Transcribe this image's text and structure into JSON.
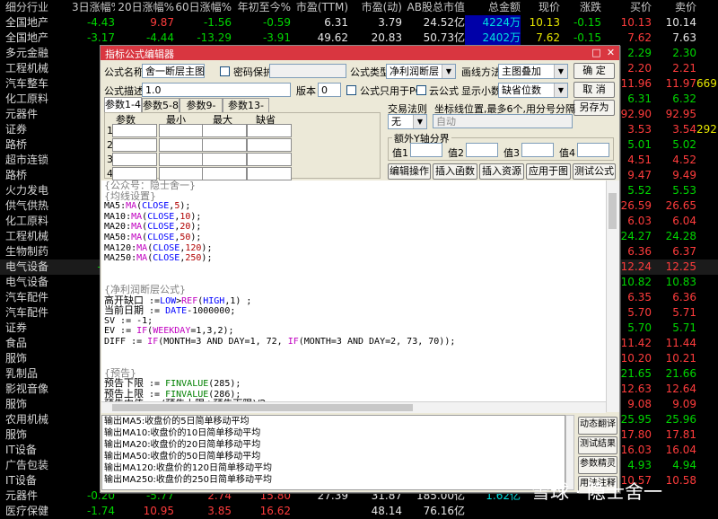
{
  "table": {
    "columns": [
      "细分行业",
      "3日涨幅%",
      "20日涨幅%",
      "60日涨幅%",
      "年初至今%",
      "市盈(TTM)",
      "市盈(动)",
      "AB股总市值",
      "总金额",
      "现价",
      "涨跌",
      "买价",
      "卖价"
    ],
    "rows": [
      [
        "全国地产",
        "-4.43",
        "9.87",
        "-1.56",
        "-0.59",
        "6.31",
        "3.79",
        "24.52亿",
        "4224万",
        "10.13",
        "-0.15",
        "10.13",
        "10.14"
      ],
      [
        "全国地产",
        "-3.17",
        "-4.44",
        "-13.29",
        "-3.91",
        "49.62",
        "20.83",
        "50.73亿",
        "2402万",
        "7.62",
        "-0.15",
        "7.62",
        "7.63"
      ],
      [
        "多元金融",
        "",
        "",
        "",
        "",
        "",
        "",
        "",
        "",
        "",
        "",
        "2.29",
        "2.30"
      ],
      [
        "工程机械",
        "",
        "",
        "",
        "",
        "",
        "",
        "",
        "",
        "",
        "",
        "2.20",
        "2.21"
      ],
      [
        "汽车整车",
        "",
        "",
        "",
        "",
        "",
        "",
        "",
        "",
        "",
        "",
        "11.96",
        "11.97"
      ],
      [
        "化工原料",
        "",
        "",
        "",
        "",
        "",
        "",
        "",
        "",
        "",
        "",
        "6.31",
        "6.32"
      ],
      [
        "元器件",
        "",
        "",
        "",
        "",
        "",
        "",
        "",
        "",
        "",
        "",
        "92.90",
        "92.95"
      ],
      [
        "证券",
        "",
        "",
        "",
        "",
        "",
        "",
        "",
        "",
        "",
        "",
        "3.53",
        "3.54"
      ],
      [
        "路桥",
        "",
        "",
        "",
        "",
        "",
        "",
        "",
        "",
        "",
        "",
        "5.01",
        "5.02"
      ],
      [
        "超市连锁",
        "",
        "",
        "",
        "",
        "",
        "",
        "",
        "",
        "",
        "",
        "4.51",
        "4.52"
      ],
      [
        "路桥",
        "",
        "",
        "",
        "",
        "",
        "",
        "",
        "",
        "",
        "",
        "9.47",
        "9.49"
      ],
      [
        "火力发电",
        "",
        "",
        "",
        "",
        "",
        "",
        "",
        "",
        "",
        "",
        "5.52",
        "5.53"
      ],
      [
        "供气供热",
        "",
        "",
        "",
        "",
        "",
        "",
        "",
        "",
        "",
        "",
        "26.59",
        "26.65"
      ],
      [
        "化工原料",
        "",
        "",
        "",
        "",
        "",
        "",
        "",
        "",
        "",
        "",
        "6.03",
        "6.04"
      ],
      [
        "工程机械",
        "",
        "",
        "",
        "",
        "",
        "",
        "",
        "",
        "",
        "",
        "24.27",
        "24.28"
      ],
      [
        "生物制药",
        "",
        "",
        "",
        "",
        "",
        "",
        "",
        "",
        "",
        "",
        "6.36",
        "6.37"
      ],
      [
        "电气设备",
        "-11",
        "",
        "",
        "",
        "",
        "",
        "",
        "",
        "",
        "",
        "12.24",
        "12.25"
      ],
      [
        "电气设备",
        "",
        "",
        "",
        "",
        "",
        "",
        "",
        "",
        "",
        "",
        "10.82",
        "10.83"
      ],
      [
        "汽车配件",
        "",
        "",
        "",
        "",
        "",
        "",
        "",
        "",
        "",
        "",
        "6.35",
        "6.36"
      ],
      [
        "汽车配件",
        "",
        "",
        "",
        "",
        "",
        "",
        "",
        "",
        "",
        "",
        "5.70",
        "5.71"
      ],
      [
        "证券",
        "",
        "",
        "",
        "",
        "",
        "",
        "",
        "",
        "",
        "",
        "5.70",
        "5.71"
      ],
      [
        "食品",
        "",
        "",
        "",
        "",
        "",
        "",
        "",
        "",
        "",
        "",
        "11.42",
        "11.44"
      ],
      [
        "服饰",
        "",
        "",
        "",
        "",
        "",
        "",
        "",
        "",
        "",
        "",
        "10.20",
        "10.21"
      ],
      [
        "乳制品",
        "",
        "",
        "",
        "",
        "",
        "",
        "",
        "",
        "",
        "",
        "21.65",
        "21.66"
      ],
      [
        "影视音像",
        "",
        "",
        "",
        "",
        "",
        "",
        "",
        "",
        "",
        "",
        "12.63",
        "12.64"
      ],
      [
        "服饰",
        "",
        "",
        "",
        "",
        "",
        "",
        "",
        "",
        "",
        "",
        "9.08",
        "9.09"
      ],
      [
        "农用机械",
        "",
        "",
        "",
        "",
        "",
        "",
        "",
        "",
        "",
        "",
        "25.95",
        "25.96"
      ],
      [
        "服饰",
        "",
        "",
        "",
        "",
        "",
        "",
        "",
        "",
        "",
        "",
        "17.80",
        "17.81"
      ],
      [
        "IT设备",
        "",
        "",
        "",
        "",
        "",
        "",
        "",
        "",
        "",
        "",
        "16.03",
        "16.04"
      ],
      [
        "广告包装",
        "",
        "",
        "",
        "",
        "",
        "",
        "",
        "",
        "",
        "",
        "4.93",
        "4.94"
      ],
      [
        "IT设备",
        "",
        "",
        "",
        "",
        "",
        "",
        "",
        "",
        "",
        "",
        "10.57",
        "10.58"
      ],
      [
        "元器件",
        "-0.20",
        "-5.77",
        "2.74",
        "15.80",
        "27.39",
        "31.87",
        "185.00亿",
        "1.62亿",
        "",
        "",
        "",
        ""
      ],
      [
        "医疗保健",
        "-1.74",
        "10.95",
        "3.85",
        "16.62",
        "",
        "48.14",
        "76.16亿",
        "",
        "",
        "",
        "",
        ""
      ]
    ],
    "right_partial": [
      "",
      "",
      "",
      "",
      "669",
      "",
      "",
      "292",
      "",
      "",
      "",
      "",
      "",
      "",
      "",
      "",
      "",
      "",
      "",
      "",
      "",
      "",
      "",
      "",
      "",
      "",
      "",
      "",
      "",
      "",
      "",
      "",
      ""
    ]
  },
  "dialog": {
    "title": "指标公式编辑器",
    "formula_name_label": "公式名称",
    "formula_name_value": "舍一断层主图",
    "password_label": "密码保护",
    "formula_type_label": "公式类型",
    "formula_type_value": "净利润断层",
    "draw_method_label": "画线方法",
    "draw_method_value": "主图叠加",
    "confirm_label": "确 定",
    "description_label": "公式描述",
    "description_value": "1.0",
    "version_label": "版本",
    "version_value": "0",
    "pc_only_label": "公式只用于PC",
    "cloud_label": "云公式",
    "decimals_label": "显示小数",
    "decimals_value": "缺省位数",
    "cancel_label": "取 消",
    "save_as_label": "另存为",
    "tabs": [
      "参数1-4",
      "参数5-8",
      "参数9-12",
      "参数13-16"
    ],
    "param_headers": [
      "参数",
      "最小",
      "最大",
      "缺省"
    ],
    "param_rows": [
      "1",
      "2",
      "3",
      "4"
    ],
    "trade_rule_label": "交易法则",
    "trade_rule_value": "无",
    "y_pos_label": "坐标线位置,最多6个,用分号分隔",
    "y_pos_value": "自动",
    "extra_y_label": "额外Y轴分界",
    "value_labels": [
      "值1",
      "值2",
      "值3",
      "值4"
    ],
    "buttons": [
      "编辑操作",
      "插入函数",
      "插入资源",
      "应用于图",
      "测试公式"
    ],
    "side_buttons": [
      "动态翻译",
      "测试结果",
      "参数精灵",
      "用法注释"
    ],
    "code": {
      "c1": "{公众号：隐士舍一}",
      "c2": "{均线设置}",
      "ma": [
        {
          "name": "MA5",
          "period": "5"
        },
        {
          "name": "MA10",
          "period": "10"
        },
        {
          "name": "MA20",
          "period": "20"
        },
        {
          "name": "MA50",
          "period": "50"
        },
        {
          "name": "MA120",
          "period": "120"
        },
        {
          "name": "MA250",
          "period": "250"
        }
      ],
      "c3": "{净利润断层公式}",
      "l1a": "高开缺口",
      "l1b": " :=",
      "l1c": "LOW",
      "l1d": ">",
      "l1e": "REF",
      "l1f": "(",
      "l1g": "HIGH",
      "l1h": ",1) ;",
      "l2a": "当前日期",
      "l2b": " := ",
      "l2c": "DATE",
      "l2d": "-1000000;",
      "l3": "SV := -1;",
      "l4a": "EV := ",
      "l4b": "IF",
      "l4c": "(",
      "l4d": "WEEKDAY",
      "l4e": "=1,3,2);",
      "l5a": "DIFF := ",
      "l5b": "IF",
      "l5c": "(MONTH=3 AND DAY=1, 72, ",
      "l5d": "IF",
      "l5e": "(MONTH=3 AND DAY=2, 73, 70));",
      "c4": "{预告}",
      "p1a": "预告下限",
      "p1b": " := ",
      "p1c": "FINVALUE",
      "p1d": "(285);",
      "p2a": "预告上限",
      "p2b": " := ",
      "p2c": "FINVALUE",
      "p2d": "(286);",
      "p3a": "预告中值",
      "p3b": " := (预告上限+预告下限)/2;"
    },
    "output": [
      "输出MA5:收盘价的5日简单移动平均",
      "输出MA10:收盘价的10日简单移动平均",
      "输出MA20:收盘价的20日简单移动平均",
      "输出MA50:收盘价的50日简单移动平均",
      "输出MA120:收盘价的120日简单移动平均",
      "输出MA250:收盘价的250日简单移动平均"
    ]
  },
  "watermark": "雪球 · 隐士舍一"
}
